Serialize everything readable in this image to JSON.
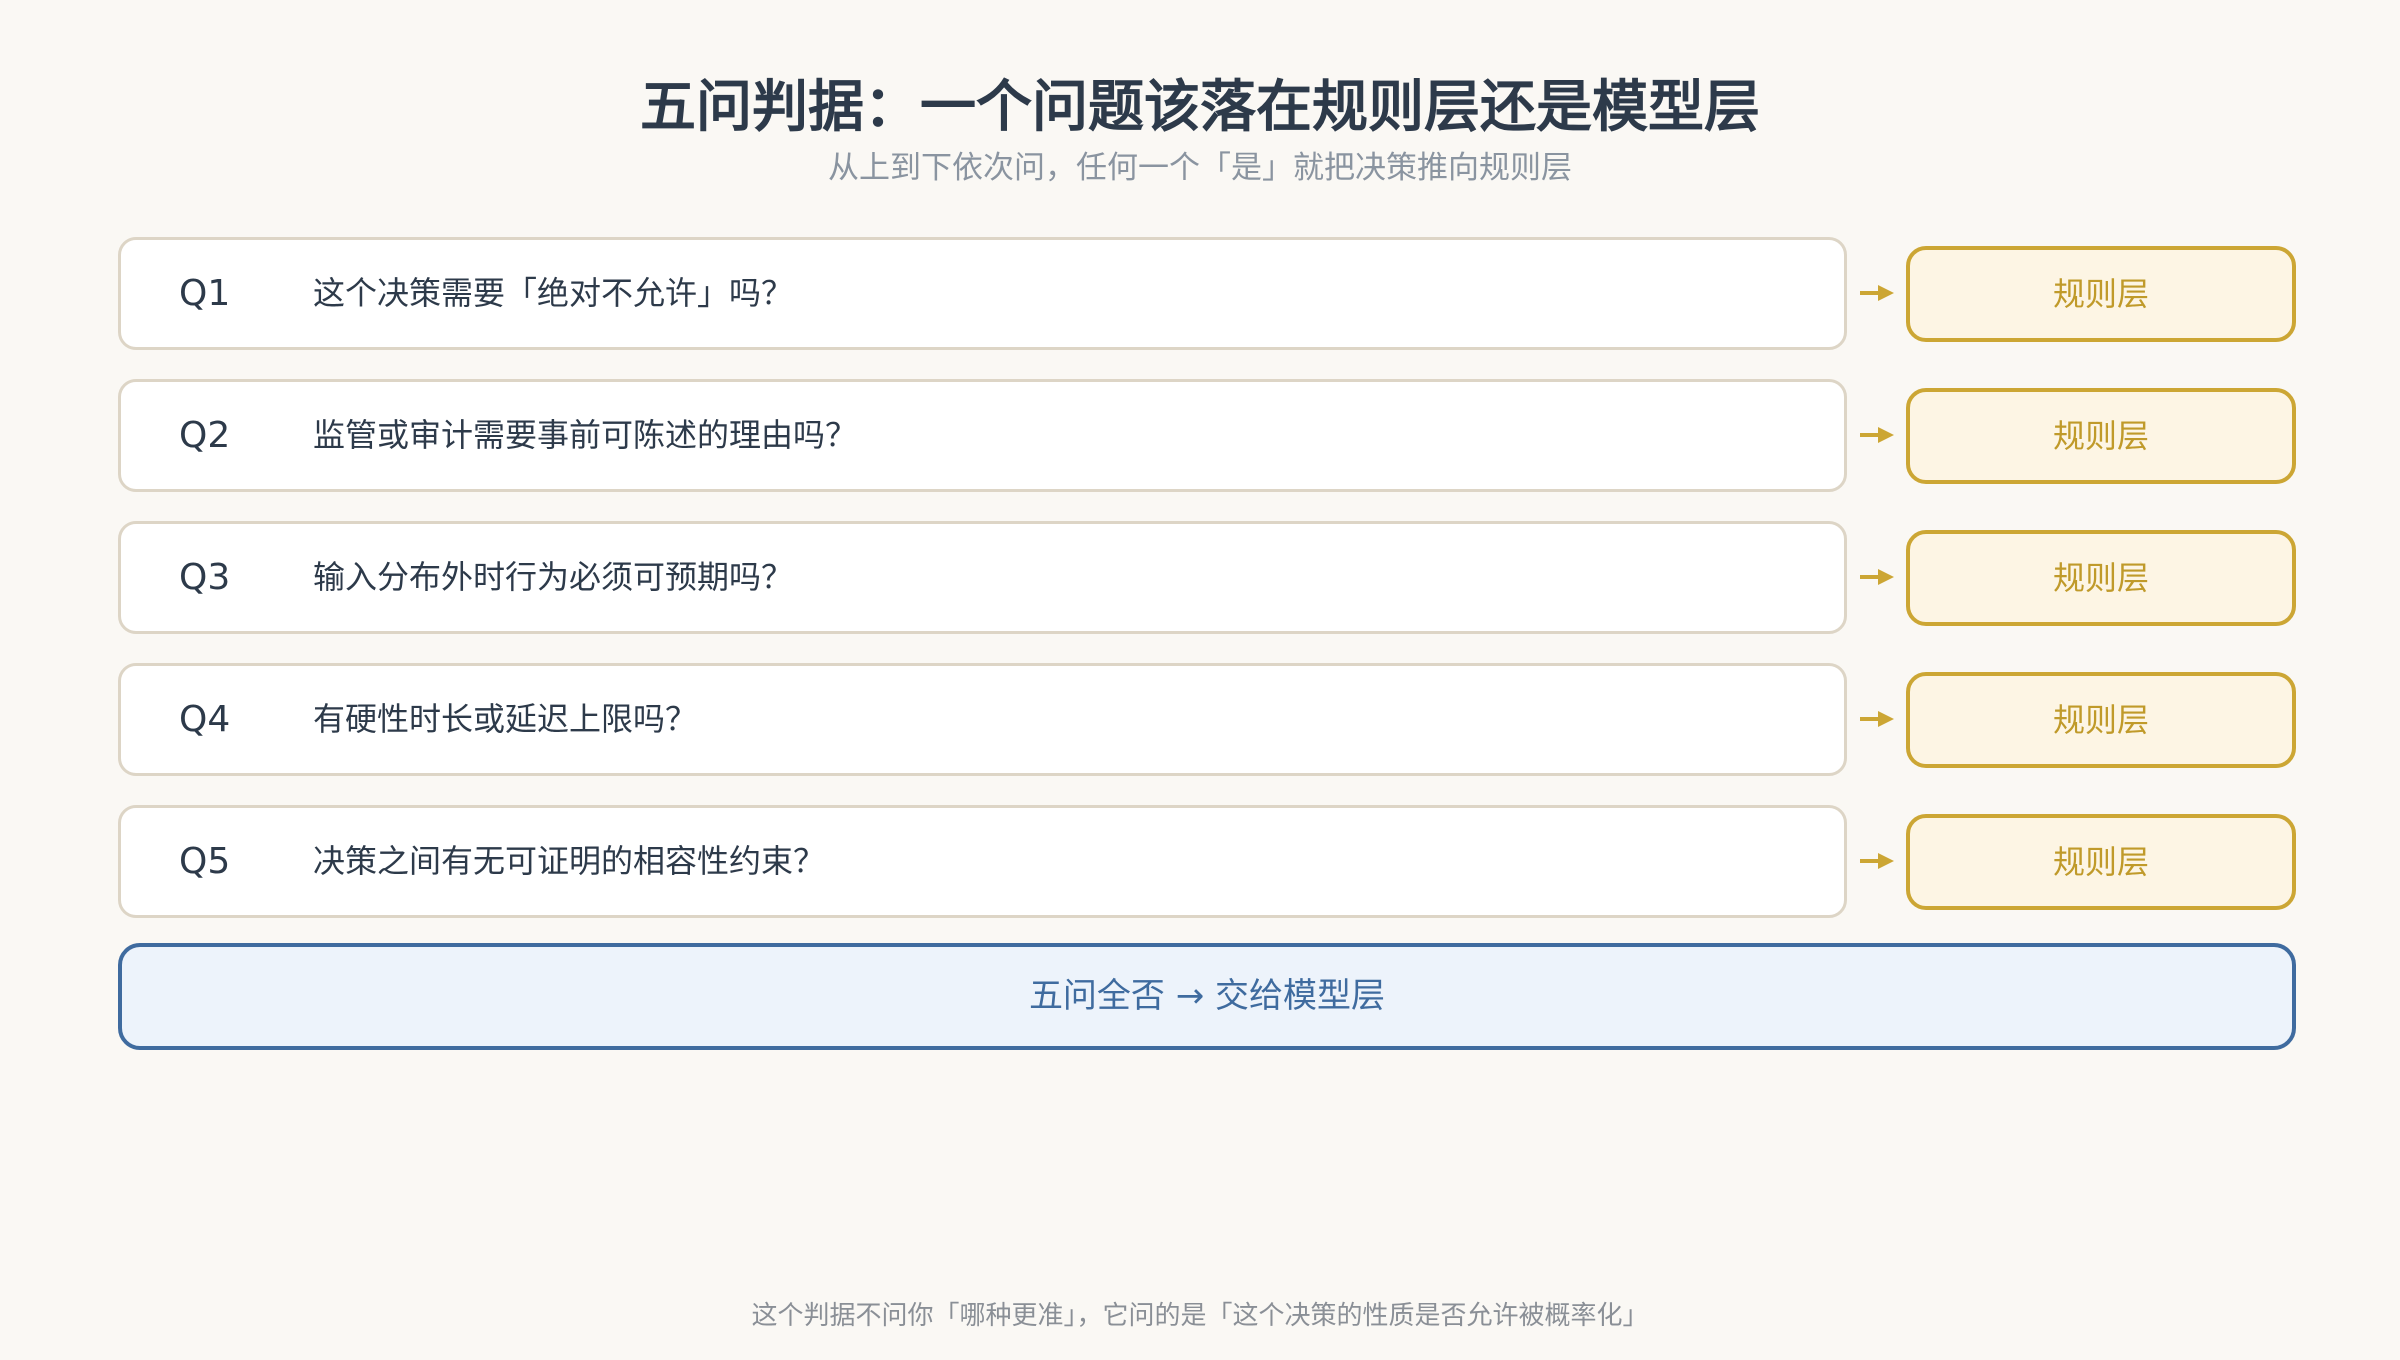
{
  "title": "五问判据：一个问题该落在规则层还是模型层",
  "subtitle": "从上到下依次问，任何一个「是」就把决策推向规则层",
  "questions": [
    {
      "id": "Q1",
      "text": "这个决策需要「绝对不允许」吗？",
      "target": "规则层"
    },
    {
      "id": "Q2",
      "text": "监管或审计需要事前可陈述的理由吗？",
      "target": "规则层"
    },
    {
      "id": "Q3",
      "text": "输入分布外时行为必须可预期吗？",
      "target": "规则层"
    },
    {
      "id": "Q4",
      "text": "有硬性时长或延迟上限吗？",
      "target": "规则层"
    },
    {
      "id": "Q5",
      "text": "决策之间有无可证明的相容性约束？",
      "target": "规则层"
    }
  ],
  "fallback": "五问全否 → 交给模型层",
  "footer": "这个判据不问你「哪种更准」，它问的是「这个决策的性质是否允许被概率化」",
  "colors": {
    "rule_accent": "#cca634",
    "model_accent": "#3f6b9f",
    "background": "#faf8f4"
  }
}
